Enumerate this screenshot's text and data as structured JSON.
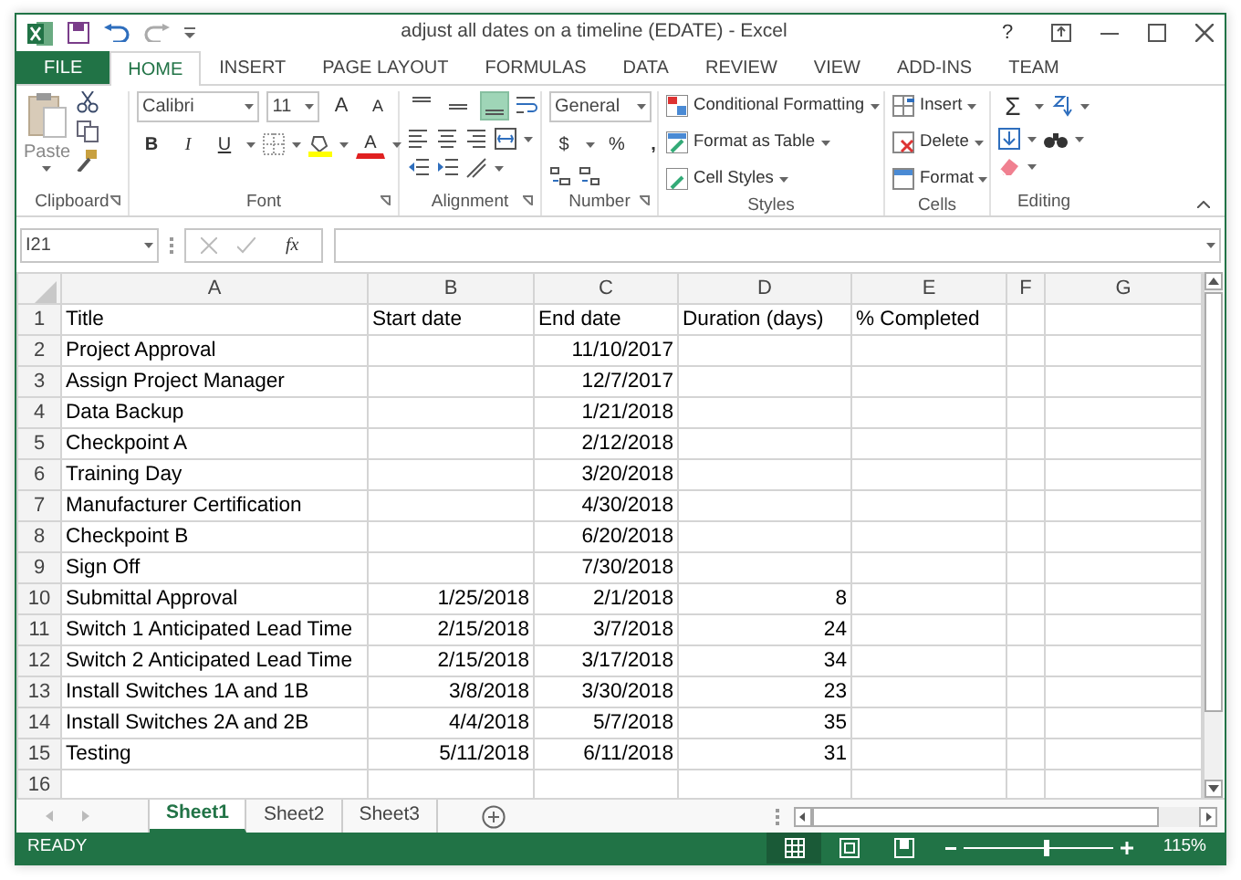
{
  "window": {
    "title": "adjust all dates on a timeline (EDATE) - Excel",
    "help": "?"
  },
  "ribbon_tabs": [
    {
      "label": "FILE",
      "kind": "file",
      "selected": false
    },
    {
      "label": "HOME",
      "kind": "tab",
      "selected": true
    },
    {
      "label": "INSERT",
      "kind": "tab",
      "selected": false
    },
    {
      "label": "PAGE LAYOUT",
      "kind": "tab",
      "selected": false
    },
    {
      "label": "FORMULAS",
      "kind": "tab",
      "selected": false
    },
    {
      "label": "DATA",
      "kind": "tab",
      "selected": false
    },
    {
      "label": "REVIEW",
      "kind": "tab",
      "selected": false
    },
    {
      "label": "VIEW",
      "kind": "tab",
      "selected": false
    },
    {
      "label": "ADD-INS",
      "kind": "tab",
      "selected": false
    },
    {
      "label": "TEAM",
      "kind": "tab",
      "selected": false
    }
  ],
  "ribbon": {
    "clipboard": {
      "paste": "Paste",
      "label": "Clipboard"
    },
    "font": {
      "font_name": "Calibri",
      "font_size": "11",
      "grow": "A",
      "shrink": "A",
      "bold": "B",
      "italic": "I",
      "underline": "U",
      "font_color": "A",
      "label": "Font"
    },
    "alignment": {
      "vertical_align": [
        {
          "selected": false
        },
        {
          "selected": false
        },
        {
          "selected": true
        }
      ],
      "label": "Alignment"
    },
    "number": {
      "format": "General",
      "currency": "$",
      "percent": "%",
      "comma": ",",
      "label": "Number"
    },
    "styles": {
      "items": [
        "Conditional Formatting",
        "Format as Table",
        "Cell Styles"
      ],
      "label": "Styles"
    },
    "cells": {
      "items": [
        "Insert",
        "Delete",
        "Format"
      ],
      "label": "Cells"
    },
    "editing": {
      "autosum": "Σ",
      "label": "Editing"
    }
  },
  "formula_bar": {
    "name_box": "I21",
    "function_label": "fx"
  },
  "columns": [
    "A",
    "B",
    "C",
    "D",
    "E",
    "F",
    "G"
  ],
  "header_row": {
    "number": "1",
    "cells": [
      "Title",
      "Start date",
      "End date",
      "Duration (days)",
      "% Completed"
    ]
  },
  "rows": [
    {
      "number": "2",
      "title": "Project Approval",
      "end": "11/10/2017"
    },
    {
      "number": "3",
      "title": "Assign Project Manager",
      "end": "12/7/2017"
    },
    {
      "number": "4",
      "title": "Data Backup",
      "end": "1/21/2018"
    },
    {
      "number": "5",
      "title": "Checkpoint A",
      "end": "2/12/2018"
    },
    {
      "number": "6",
      "title": "Training Day",
      "end": "3/20/2018"
    },
    {
      "number": "7",
      "title": "Manufacturer Certification",
      "end": "4/30/2018"
    },
    {
      "number": "8",
      "title": "Checkpoint B",
      "end": "6/20/2018"
    },
    {
      "number": "9",
      "title": "Sign Off",
      "end": "7/30/2018"
    },
    {
      "number": "10",
      "title": "Submittal Approval",
      "start": "1/25/2018",
      "end": "2/1/2018",
      "duration": "8"
    },
    {
      "number": "11",
      "title": "Switch 1 Anticipated Lead Time",
      "start": "2/15/2018",
      "end": "3/7/2018",
      "duration": "24"
    },
    {
      "number": "12",
      "title": "Switch 2 Anticipated Lead Time",
      "start": "2/15/2018",
      "end": "3/17/2018",
      "duration": "34"
    },
    {
      "number": "13",
      "title": "Install Switches 1A and 1B",
      "start": "3/8/2018",
      "end": "3/30/2018",
      "duration": "23"
    },
    {
      "number": "14",
      "title": "Install Switches 2A and 2B",
      "start": "4/4/2018",
      "end": "5/7/2018",
      "duration": "35"
    },
    {
      "number": "15",
      "title": "Testing",
      "start": "5/11/2018",
      "end": "6/11/2018",
      "duration": "31"
    },
    {
      "number": "16"
    }
  ],
  "sheet_tabs": [
    {
      "label": "Sheet1",
      "selected": true
    },
    {
      "label": "Sheet2",
      "selected": false
    },
    {
      "label": "Sheet3",
      "selected": false
    }
  ],
  "status_bar": {
    "status": "READY",
    "views": [
      {
        "selected": true
      },
      {
        "selected": false
      },
      {
        "selected": false
      }
    ],
    "zoom": {
      "level": 0.55
    },
    "zoom_label": "115%"
  }
}
